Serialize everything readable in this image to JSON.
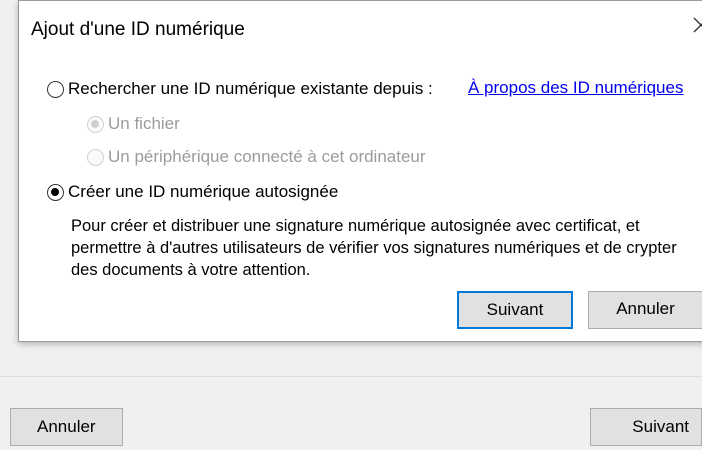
{
  "dialog": {
    "title": "Ajout d'une ID numérique",
    "option_search_label": "Rechercher une ID numérique existante depuis :",
    "about_link": "À propos des ID numériques",
    "sub_option_file": "Un fichier",
    "sub_option_device": "Un périphérique connecté à cet ordinateur",
    "option_create_label": "Créer une ID numérique autosignée",
    "description": "Pour créer et distribuer une signature numérique autosignée avec certificat, et permettre à d'autres utilisateurs de vérifier vos signatures numériques et de crypter des documents à votre attention.",
    "next_label": "Suivant",
    "cancel_label": "Annuler"
  },
  "background": {
    "cancel_label": "Annuler",
    "next_label": "Suivant"
  },
  "colors": {
    "link": "#0000ee",
    "focus_border": "#0078d7",
    "disabled_text": "#9c9c9c"
  }
}
